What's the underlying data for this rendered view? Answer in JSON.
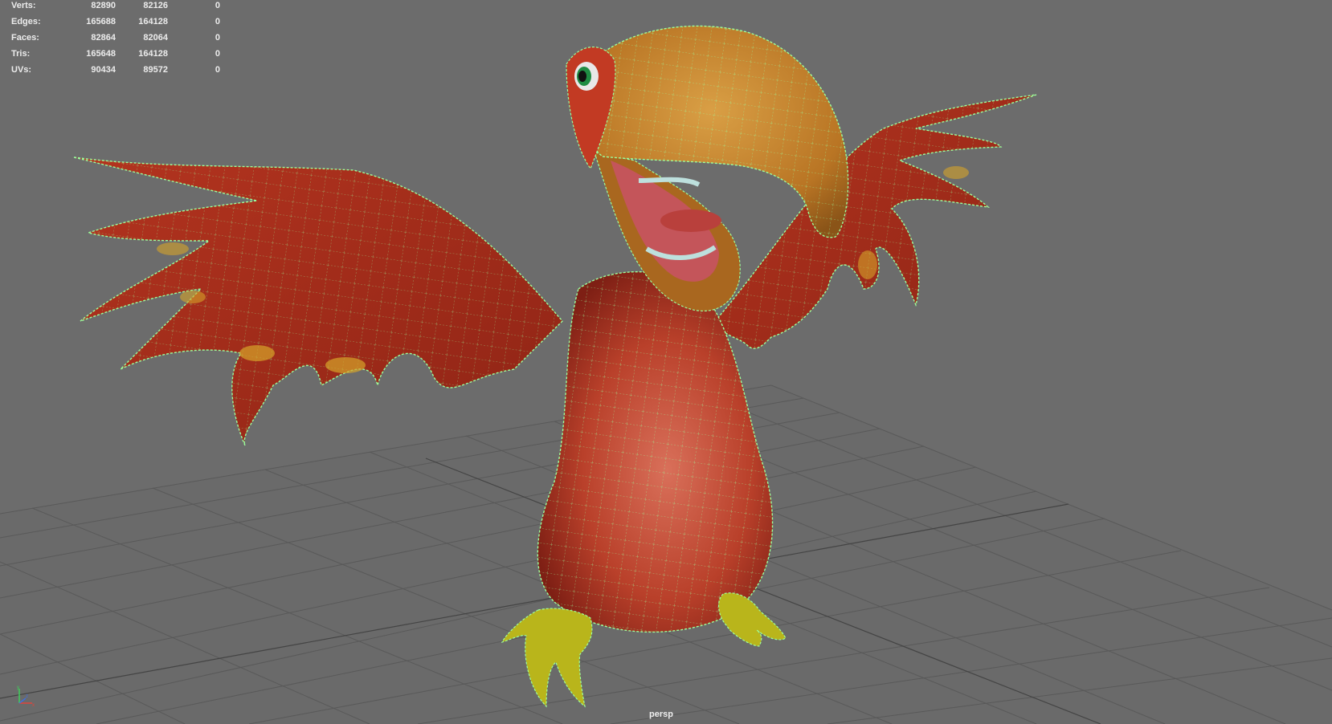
{
  "hud": {
    "rows": [
      {
        "label": "Verts:",
        "c1": "82890",
        "c2": "82126",
        "c3": "0"
      },
      {
        "label": "Edges:",
        "c1": "165688",
        "c2": "164128",
        "c3": "0"
      },
      {
        "label": "Faces:",
        "c1": "82864",
        "c2": "82064",
        "c3": "0"
      },
      {
        "label": "Tris:",
        "c1": "165648",
        "c2": "164128",
        "c3": "0"
      },
      {
        "label": "UVs:",
        "c1": "90434",
        "c2": "89572",
        "c3": "0"
      }
    ]
  },
  "viewport": {
    "camera_label": "persp"
  },
  "axis_gizmo": {
    "icon": "xyz-axis-gizmo-icon"
  },
  "colors": {
    "background": "#6c6c6c",
    "grid_line": "#5a5a5a",
    "grid_axis": "#3e3e3e",
    "wireframe": "#9cff9c",
    "body_red": "#c23a23",
    "beak_orange": "#c98a2e",
    "feet_yellow": "#c9c21e"
  }
}
